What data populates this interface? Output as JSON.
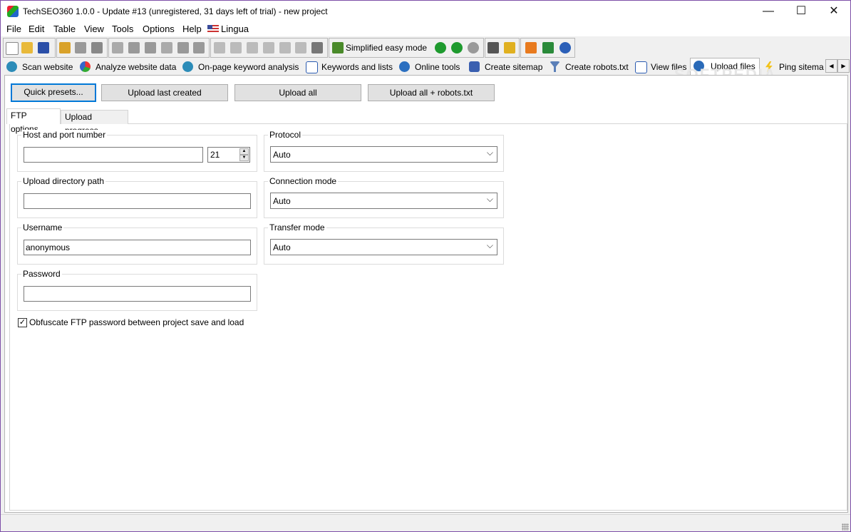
{
  "window": {
    "title": "TechSEO360 1.0.0 - Update #13 (unregistered, 31 days left of trial) - new project",
    "controls": {
      "minimize": "—",
      "maximize": "☐",
      "close": "✕"
    }
  },
  "menu": [
    "File",
    "Edit",
    "Table",
    "View",
    "Tools",
    "Options",
    "Help",
    "Lingua"
  ],
  "toolbar": {
    "mode_label": "Simplified easy mode"
  },
  "tabs": [
    {
      "label": "Scan website",
      "icon": "scan-icon"
    },
    {
      "label": "Analyze website data",
      "icon": "chart-icon"
    },
    {
      "label": "On-page keyword analysis",
      "icon": "search-icon"
    },
    {
      "label": "Keywords and lists",
      "icon": "list-icon"
    },
    {
      "label": "Online tools",
      "icon": "globe-icon"
    },
    {
      "label": "Create sitemap",
      "icon": "sitemap-icon"
    },
    {
      "label": "Create robots.txt",
      "icon": "filter-icon"
    },
    {
      "label": "View files",
      "icon": "files-icon"
    },
    {
      "label": "Upload files",
      "icon": "upload-icon"
    },
    {
      "label": "Ping sitema",
      "icon": "ping-icon"
    }
  ],
  "active_tab": "Upload files",
  "watermark": "SOFTPEDIA",
  "actions": {
    "quick_presets": "Quick presets...",
    "upload_last": "Upload last created",
    "upload_all": "Upload all",
    "upload_all_robots": "Upload all + robots.txt"
  },
  "subtabs": [
    "FTP options",
    "Upload progress"
  ],
  "ftp": {
    "host_label": "Host and port number",
    "host_value": "",
    "port_value": "21",
    "upload_dir_label": "Upload directory path",
    "upload_dir_value": "",
    "username_label": "Username",
    "username_value": "anonymous",
    "password_label": "Password",
    "password_value": "",
    "protocol_label": "Protocol",
    "protocol_value": "Auto",
    "connection_label": "Connection mode",
    "connection_value": "Auto",
    "transfer_label": "Transfer mode",
    "transfer_value": "Auto",
    "obfuscate_label": "Obfuscate FTP password between project save and load",
    "obfuscate_checked": true
  }
}
